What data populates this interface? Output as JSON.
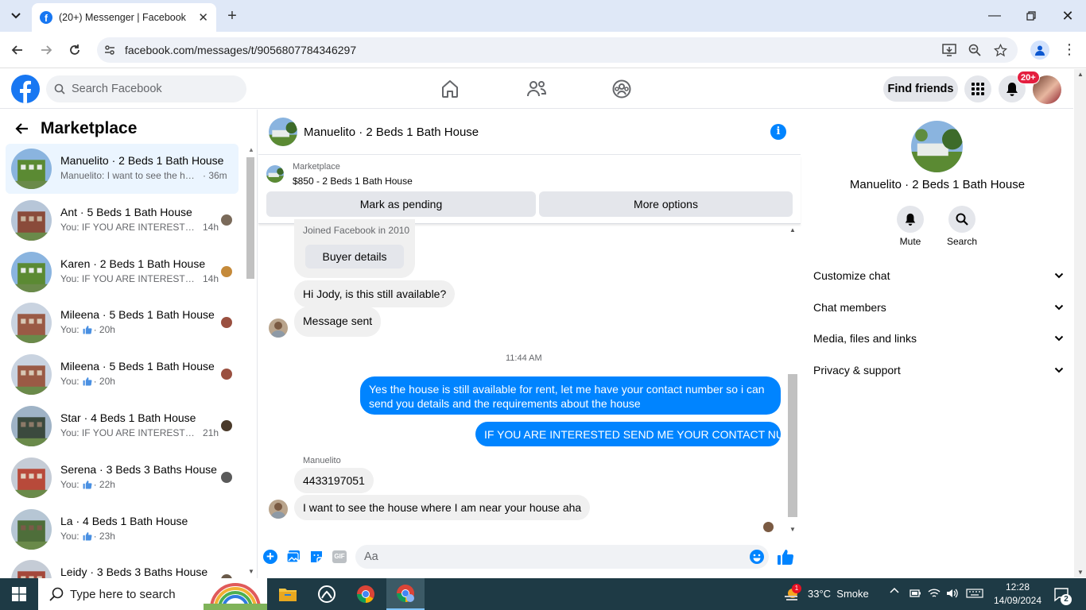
{
  "browser": {
    "tab_title": "(20+) Messenger | Facebook",
    "url": "facebook.com/messages/t/9056807784346297"
  },
  "fb": {
    "search_placeholder": "Search Facebook",
    "find_friends": "Find friends",
    "notif_badge": "20+"
  },
  "left": {
    "title": "Marketplace",
    "conversations": [
      {
        "name": "Manuelito · 2 Beds 1 Bath House",
        "snippet": "Manuelito: I want to see the hou...",
        "time": "· 36m",
        "thumb": false
      },
      {
        "name": "Ant · 5 Beds 1 Bath House",
        "snippet": "You: IF YOU ARE INTERESTED S...",
        "time": "14h",
        "thumb": false
      },
      {
        "name": "Karen · 2 Beds 1 Bath House",
        "snippet": "You: IF YOU ARE INTERESTED S...",
        "time": "14h",
        "thumb": false
      },
      {
        "name": "Mileena · 5 Beds 1 Bath House",
        "snippet": "You:",
        "time": "· 20h",
        "thumb": true
      },
      {
        "name": "Mileena · 5 Beds 1 Bath House",
        "snippet": "You:",
        "time": "· 20h",
        "thumb": true
      },
      {
        "name": "Star · 4 Beds 1 Bath House",
        "snippet": "You: IF YOU ARE INTERESTED S...",
        "time": "21h",
        "thumb": false
      },
      {
        "name": "Serena · 3 Beds 3 Baths House",
        "snippet": "You:",
        "time": "· 22h",
        "thumb": true
      },
      {
        "name": "La · 4 Beds 1 Bath House",
        "snippet": "You:",
        "time": "· 23h",
        "thumb": true
      },
      {
        "name": "Leidy · 3 Beds 3 Baths House",
        "snippet": "",
        "time": "",
        "thumb": false
      }
    ]
  },
  "chat": {
    "header_title": "Manuelito · 2 Beds 1 Bath House",
    "mp_label": "Marketplace",
    "mp_listing": "$850 - 2 Beds 1 Bath House",
    "mark_pending": "Mark as pending",
    "more_options": "More options",
    "joined": "Joined Facebook in 2010",
    "buyer_details": "Buyer details",
    "msg_available": "Hi Jody, is this still available?",
    "msg_sent": "Message sent",
    "timestamp": "11:44 AM",
    "out1": "Yes the house is still available for rent, let me have your contact number so i can send you details and the requirements about the house",
    "out2": "IF YOU ARE INTERESTED SEND ME YOUR CONTACT NUMBER",
    "sender_name": "Manuelito",
    "in_number": "4433197051",
    "in_last": "I want to see the house where I am near your house aha",
    "input_placeholder": "Aa"
  },
  "right": {
    "name": "Manuelito · 2 Beds 1 Bath House",
    "mute": "Mute",
    "search": "Search",
    "sections": [
      "Customize chat",
      "Chat members",
      "Media, files and links",
      "Privacy & support"
    ]
  },
  "taskbar": {
    "search_placeholder": "Type here to search",
    "weather": "33°C  Smoke",
    "time": "12:28",
    "date": "14/09/2024",
    "notif_count": "2",
    "weather_badge": "1"
  },
  "colors": {
    "fb_blue": "#1877f2",
    "messenger_blue": "#0084ff",
    "active_row": "#ebf5ff",
    "taskbar": "#1e3a45"
  }
}
